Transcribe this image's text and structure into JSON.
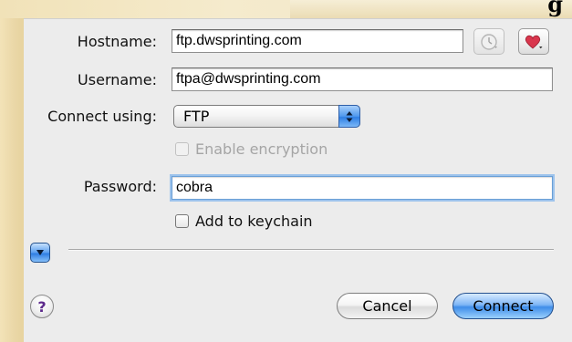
{
  "banner": {
    "text": "g"
  },
  "form": {
    "hostname": {
      "label": "Hostname:",
      "value": "ftp.dwsprinting.com"
    },
    "username": {
      "label": "Username:",
      "value": "ftpa@dwsprinting.com"
    },
    "connect_using": {
      "label": "Connect using:",
      "selected": "FTP"
    },
    "encryption": {
      "label": "Enable encryption",
      "checked": false,
      "enabled": false
    },
    "password": {
      "label": "Password:",
      "value": "cobra"
    },
    "keychain": {
      "label": "Add to keychain",
      "checked": false
    }
  },
  "icons": {
    "history": "clock-icon",
    "favorites": "heart-icon",
    "disclosure": "triangle-down-icon",
    "help": "question-mark-icon"
  },
  "buttons": {
    "help_symbol": "?",
    "cancel": "Cancel",
    "connect": "Connect"
  },
  "colors": {
    "accent": "#3f8de9",
    "focus_ring": "#9dc3ec",
    "heart": "#d9364d",
    "help_glyph": "#5d2a8c"
  }
}
